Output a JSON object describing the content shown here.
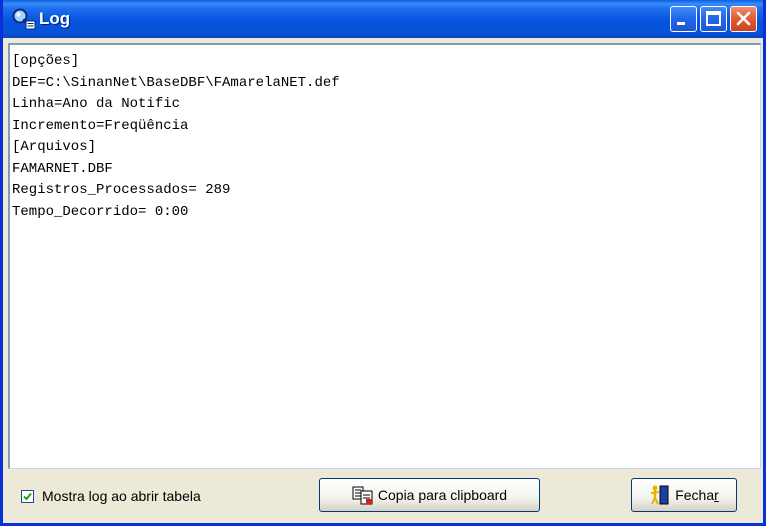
{
  "window": {
    "title": "Log",
    "controls": [
      "minimize-icon",
      "maximize-icon",
      "close-icon"
    ]
  },
  "log": {
    "lines": [
      "[opções]",
      "DEF=C:\\SinanNet\\BaseDBF\\FAmarelaNET.def",
      "Linha=Ano da Notific",
      "Incremento=Freqüência",
      "[Arquivos]",
      "FAMARNET.DBF",
      "Registros_Processados= 289",
      "Tempo_Decorrido= 0:00"
    ]
  },
  "footer": {
    "checkbox_label": "Mostra log ao abrir tabela",
    "checkbox_checked": true,
    "copy_button_label": "Copia para clipboard",
    "close_button_label_main": "Fecha",
    "close_button_label_accel": "r"
  },
  "colors": {
    "titlebar": "#0553df",
    "background": "#ece9d8",
    "close_button": "#e05a34"
  }
}
